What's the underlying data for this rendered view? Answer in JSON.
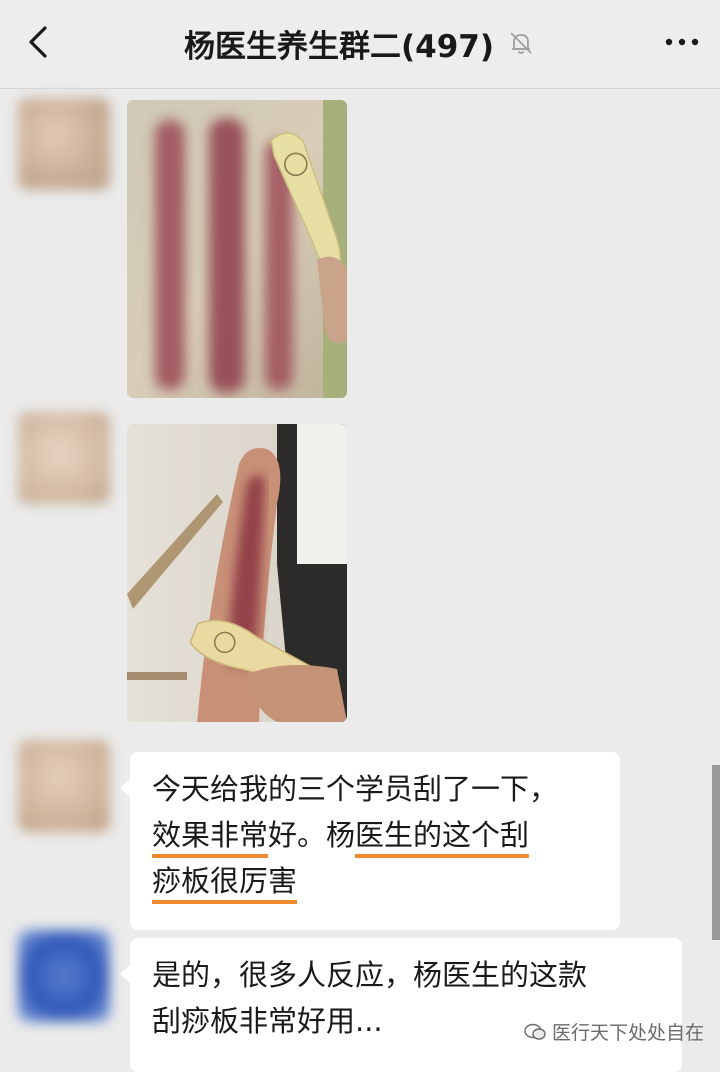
{
  "header": {
    "title": "杨医生养生群二(497)",
    "back_icon": "chevron-left-icon",
    "mute_icon": "bell-off-icon",
    "more_icon": "more-horizontal-icon"
  },
  "messages": [
    {
      "type": "image",
      "content": "back-gua-sha-photo"
    },
    {
      "type": "image",
      "content": "arm-gua-sha-photo"
    },
    {
      "type": "text",
      "lines": [
        "今天给我的三个学员刮了一下，",
        "效果非常好。杨医生的这个刮",
        "痧板很厉害"
      ]
    },
    {
      "type": "text",
      "lines": [
        "是的，很多人反应，杨医生的这款",
        "刮痧板非常好用..."
      ]
    }
  ],
  "watermark": {
    "text": "医行天下处处自在"
  },
  "colors": {
    "accent_underline": "#f08a2e",
    "background": "#ebebeb",
    "bubble": "#ffffff"
  }
}
